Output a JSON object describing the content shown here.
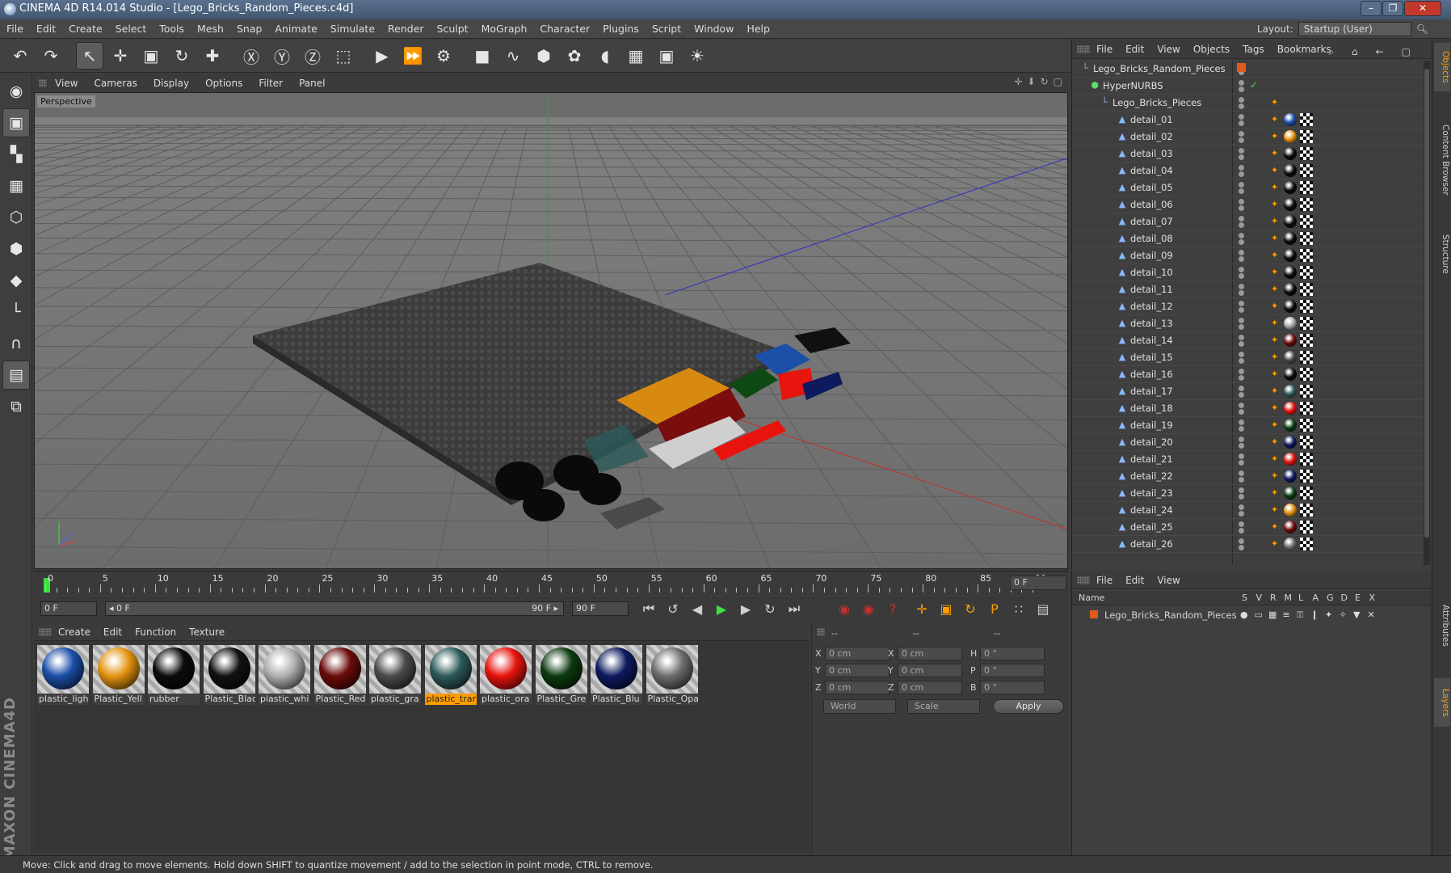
{
  "app": {
    "title": "CINEMA 4D R14.014 Studio - [Lego_Bricks_Random_Pieces.c4d]",
    "window_buttons": [
      "–",
      "❐",
      "✕"
    ]
  },
  "menu": [
    "File",
    "Edit",
    "Create",
    "Select",
    "Tools",
    "Mesh",
    "Snap",
    "Animate",
    "Simulate",
    "Render",
    "Sculpt",
    "MoGraph",
    "Character",
    "Plugins",
    "Script",
    "Window",
    "Help"
  ],
  "layout": {
    "label": "Layout:",
    "value": "Startup (User)"
  },
  "toolbar": {
    "groups": [
      [
        {
          "icon": "undo-icon",
          "glyph": "↶"
        },
        {
          "icon": "redo-icon",
          "glyph": "↷"
        }
      ],
      [
        {
          "icon": "live-selection-icon",
          "glyph": "↖",
          "on": true
        },
        {
          "icon": "move-icon",
          "glyph": "✛"
        },
        {
          "icon": "scale-icon",
          "glyph": "▣"
        },
        {
          "icon": "rotate-icon",
          "glyph": "↻"
        },
        {
          "icon": "add-object-icon",
          "glyph": "✚"
        }
      ],
      [
        {
          "icon": "x-axis-icon",
          "glyph": "Ⓧ"
        },
        {
          "icon": "y-axis-icon",
          "glyph": "Ⓨ"
        },
        {
          "icon": "z-axis-icon",
          "glyph": "Ⓩ"
        },
        {
          "icon": "coordinate-system-icon",
          "glyph": "⬚"
        }
      ],
      [
        {
          "icon": "render-view-icon",
          "glyph": "▶"
        },
        {
          "icon": "render-to-picture-viewer-icon",
          "glyph": "⏩"
        },
        {
          "icon": "render-settings-icon",
          "glyph": "⚙"
        }
      ],
      [
        {
          "icon": "cube-icon",
          "glyph": "■"
        },
        {
          "icon": "spline-icon",
          "glyph": "∿"
        },
        {
          "icon": "nurbs-icon",
          "glyph": "⬢"
        },
        {
          "icon": "array-icon",
          "glyph": "✿"
        },
        {
          "icon": "deformer-icon",
          "glyph": "◖"
        },
        {
          "icon": "floor-icon",
          "glyph": "▦"
        },
        {
          "icon": "camera-icon",
          "glyph": "▣"
        },
        {
          "icon": "light-icon",
          "glyph": "☀"
        }
      ]
    ]
  },
  "left_tools": [
    {
      "icon": "make-editable-icon",
      "glyph": "◉"
    },
    {
      "icon": "model-mode-icon",
      "glyph": "▣",
      "on": true
    },
    {
      "icon": "texture-mode-icon",
      "glyph": "▚"
    },
    {
      "icon": "workplane-mode-icon",
      "glyph": "▦"
    },
    {
      "icon": "points-mode-icon",
      "glyph": "⬡"
    },
    {
      "icon": "edges-mode-icon",
      "glyph": "⬢"
    },
    {
      "icon": "polygons-mode-icon",
      "glyph": "◆"
    },
    {
      "icon": "axis-mode-icon",
      "glyph": "└"
    },
    {
      "icon": "magnet-icon",
      "glyph": "∩"
    },
    {
      "icon": "locked-workplane-icon",
      "glyph": "▤",
      "on": true
    },
    {
      "icon": "snap-icon",
      "glyph": "⧉"
    }
  ],
  "maxon_logo": "MAXON CINEMA4D",
  "viewport": {
    "menu": [
      "View",
      "Cameras",
      "Display",
      "Options",
      "Filter",
      "Panel"
    ],
    "label": "Perspective",
    "nav_icons": [
      "✛",
      "⬇",
      "↻",
      "▢"
    ]
  },
  "timeline": {
    "ticks": [
      "0",
      "5",
      "10",
      "15",
      "20",
      "25",
      "30",
      "35",
      "40",
      "45",
      "50",
      "55",
      "60",
      "65",
      "70",
      "75",
      "80",
      "85",
      "90"
    ],
    "current_frame": "0 F"
  },
  "transport": {
    "start_field": "0 F",
    "range_left": "◂ 0 F",
    "range_right": "90 F ▸",
    "end_field": "90 F",
    "buttons": [
      {
        "icon": "go-to-start-icon",
        "glyph": "⏮"
      },
      {
        "icon": "previous-key-icon",
        "glyph": "↺"
      },
      {
        "icon": "previous-frame-icon",
        "glyph": "◀"
      },
      {
        "icon": "play-forwards-icon",
        "glyph": "▶",
        "color": "#3fe040"
      },
      {
        "icon": "next-frame-icon",
        "glyph": "▶"
      },
      {
        "icon": "next-key-icon",
        "glyph": "↻"
      },
      {
        "icon": "go-to-end-icon",
        "glyph": "⏭"
      }
    ],
    "record": [
      {
        "icon": "record-active-objects-icon",
        "glyph": "◉",
        "color": "#c43030"
      },
      {
        "icon": "autokeying-icon",
        "glyph": "◉",
        "color": "#c43030"
      },
      {
        "icon": "keyframe-selection-icon",
        "glyph": "?",
        "color": "#c43030"
      }
    ],
    "key_icons": [
      {
        "icon": "key-position-icon",
        "glyph": "✛"
      },
      {
        "icon": "key-scale-icon",
        "glyph": "▣"
      },
      {
        "icon": "key-rotation-icon",
        "glyph": "↻"
      },
      {
        "icon": "key-parameter-icon",
        "glyph": "P"
      },
      {
        "icon": "key-pla-icon",
        "glyph": "∷"
      },
      {
        "icon": "timeline-window-icon",
        "glyph": "▤"
      }
    ]
  },
  "materials": {
    "menu": [
      "Create",
      "Edit",
      "Function",
      "Texture"
    ],
    "items": [
      {
        "label": "plastic_ligh",
        "color": "#1b4fa8"
      },
      {
        "label": "Plastic_Yell",
        "color": "#e49411"
      },
      {
        "label": "rubber",
        "color": "#0c0c0c"
      },
      {
        "label": "Plastic_Blac",
        "color": "#111111"
      },
      {
        "label": "plastic_whi",
        "color": "#b0b0b0"
      },
      {
        "label": "Plastic_Red",
        "color": "#6a0b0b"
      },
      {
        "label": "plastic_gra",
        "color": "#4a4a4a"
      },
      {
        "label": "plastic_trar",
        "color": "#2d5a5a",
        "selected": true
      },
      {
        "label": "plastic_ora",
        "color": "#e8140e"
      },
      {
        "label": "Plastic_Gre",
        "color": "#0c3a10"
      },
      {
        "label": "Plastic_Blu",
        "color": "#0d1a5e"
      },
      {
        "label": "Plastic_Opa",
        "color": "#6e6e6e"
      }
    ]
  },
  "coords": {
    "headers": [
      "--",
      "--",
      "--"
    ],
    "rows": [
      {
        "l1": "X",
        "v1": "0 cm",
        "l2": "X",
        "v2": "0 cm",
        "l3": "H",
        "v3": "0 °"
      },
      {
        "l1": "Y",
        "v1": "0 cm",
        "l2": "Y",
        "v2": "0 cm",
        "l3": "P",
        "v3": "0 °"
      },
      {
        "l1": "Z",
        "v1": "0 cm",
        "l2": "Z",
        "v2": "0 cm",
        "l3": "B",
        "v3": "0 °"
      }
    ],
    "world": "World",
    "scale": "Scale",
    "apply": "Apply"
  },
  "objects": {
    "menu": [
      "File",
      "Edit",
      "View",
      "Objects",
      "Tags",
      "Bookmarks"
    ],
    "root": "Lego_Bricks_Random_Pieces",
    "hypernurbs": "HyperNURBS",
    "group": "Lego_Bricks_Pieces",
    "details": [
      {
        "name": "detail_01",
        "color": "#1b4fa8"
      },
      {
        "name": "detail_02",
        "color": "#e49411"
      },
      {
        "name": "detail_03",
        "color": "#0c0c0c"
      },
      {
        "name": "detail_04",
        "color": "#0c0c0c"
      },
      {
        "name": "detail_05",
        "color": "#0c0c0c"
      },
      {
        "name": "detail_06",
        "color": "#0c0c0c"
      },
      {
        "name": "detail_07",
        "color": "#0c0c0c"
      },
      {
        "name": "detail_08",
        "color": "#0c0c0c"
      },
      {
        "name": "detail_09",
        "color": "#0c0c0c"
      },
      {
        "name": "detail_10",
        "color": "#0c0c0c"
      },
      {
        "name": "detail_11",
        "color": "#0c0c0c"
      },
      {
        "name": "detail_12",
        "color": "#0c0c0c"
      },
      {
        "name": "detail_13",
        "color": "#a8a8a8"
      },
      {
        "name": "detail_14",
        "color": "#6a0b0b"
      },
      {
        "name": "detail_15",
        "color": "#4a4a4a"
      },
      {
        "name": "detail_16",
        "color": "#0c0c0c"
      },
      {
        "name": "detail_17",
        "color": "#2d5a5a"
      },
      {
        "name": "detail_18",
        "color": "#e8140e"
      },
      {
        "name": "detail_19",
        "color": "#0c3a10"
      },
      {
        "name": "detail_20",
        "color": "#0d1a5e"
      },
      {
        "name": "detail_21",
        "color": "#e8140e"
      },
      {
        "name": "detail_22",
        "color": "#0d1a5e"
      },
      {
        "name": "detail_23",
        "color": "#0c3a10"
      },
      {
        "name": "detail_24",
        "color": "#e49411"
      },
      {
        "name": "detail_25",
        "color": "#6a0b0b"
      },
      {
        "name": "detail_26",
        "color": "#6e6e6e"
      }
    ]
  },
  "layers": {
    "menu": [
      "File",
      "Edit",
      "View"
    ],
    "header": {
      "name": "Name",
      "cols": [
        "S",
        "V",
        "R",
        "M",
        "L",
        "A",
        "G",
        "D",
        "E",
        "X"
      ]
    },
    "row": "Lego_Bricks_Random_Pieces"
  },
  "right_tabs": [
    "Objects",
    "Content Browser",
    "Structure",
    "Attributes",
    "Layers"
  ],
  "status": "Move: Click and drag to move elements. Hold down SHIFT to quantize movement / add to the selection in point mode, CTRL to remove."
}
